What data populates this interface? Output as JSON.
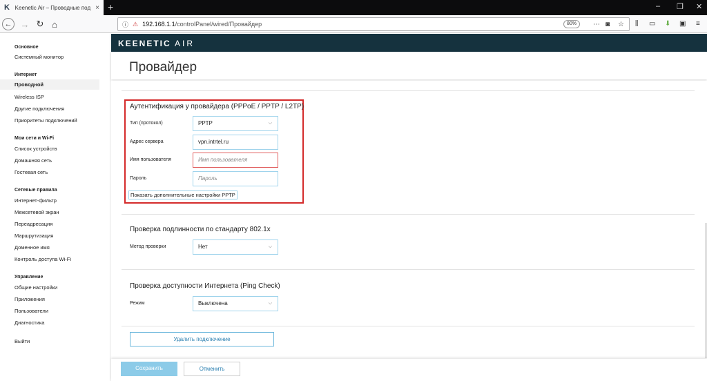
{
  "browser": {
    "tab_title": "Keenetic Air – Проводные под",
    "tab_close": "×",
    "new_tab": "+",
    "url_host": "192.168.1.1",
    "url_path": "/controlPanel/wired/Провайдер",
    "zoom": "80%",
    "win_min": "–",
    "win_max": "❐",
    "win_close": "✕"
  },
  "sidebar": {
    "groups": [
      {
        "title": "Основное",
        "items": [
          "Системный монитор"
        ]
      },
      {
        "title": "Интернет",
        "items": [
          "Проводной",
          "Wireless ISP",
          "Другие подключения",
          "Приоритеты подключений"
        ]
      },
      {
        "title": "Мои сети и Wi-Fi",
        "items": [
          "Список устройств",
          "Домашняя сеть",
          "Гостевая сеть"
        ]
      },
      {
        "title": "Сетевые правила",
        "items": [
          "Интернет-фильтр",
          "Межсетевой экран",
          "Переадресация",
          "Маршрутизация",
          "Доменное имя",
          "Контроль доступа Wi-Fi"
        ]
      },
      {
        "title": "Управление",
        "items": [
          "Общие настройки",
          "Приложения",
          "Пользователи",
          "Диагностика"
        ]
      }
    ],
    "logout": "Выйти"
  },
  "header": {
    "brand_main": "KEENETIC",
    "brand_sub": "AIR"
  },
  "page": {
    "title": "Провайдер"
  },
  "auth": {
    "title": "Аутентификация у провайдера (PPPoE / PPTP / L2TP)",
    "type_label": "Тип (протокол)",
    "type_value": "PPTP",
    "server_label": "Адрес сервера",
    "server_value": "vpn.intrtel.ru",
    "user_label": "Имя пользователя",
    "user_placeholder": "Имя пользователя",
    "password_label": "Пароль",
    "password_placeholder": "Пароль",
    "more_link": "Показать дополнительные настройки PPTP"
  },
  "dot1x": {
    "title": "Проверка подлинности по стандарту 802.1x",
    "method_label": "Метод проверки",
    "method_value": "Нет"
  },
  "ping": {
    "title": "Проверка доступности Интернета (Ping Check)",
    "mode_label": "Режим",
    "mode_value": "Выключена"
  },
  "actions": {
    "delete": "Удалить подключение",
    "save": "Сохранить",
    "cancel": "Отменить"
  },
  "colors": {
    "header_bg": "#15323e",
    "accent": "#6bb7dc",
    "error": "#d42a2a",
    "save_bg": "#8ccbe8"
  }
}
